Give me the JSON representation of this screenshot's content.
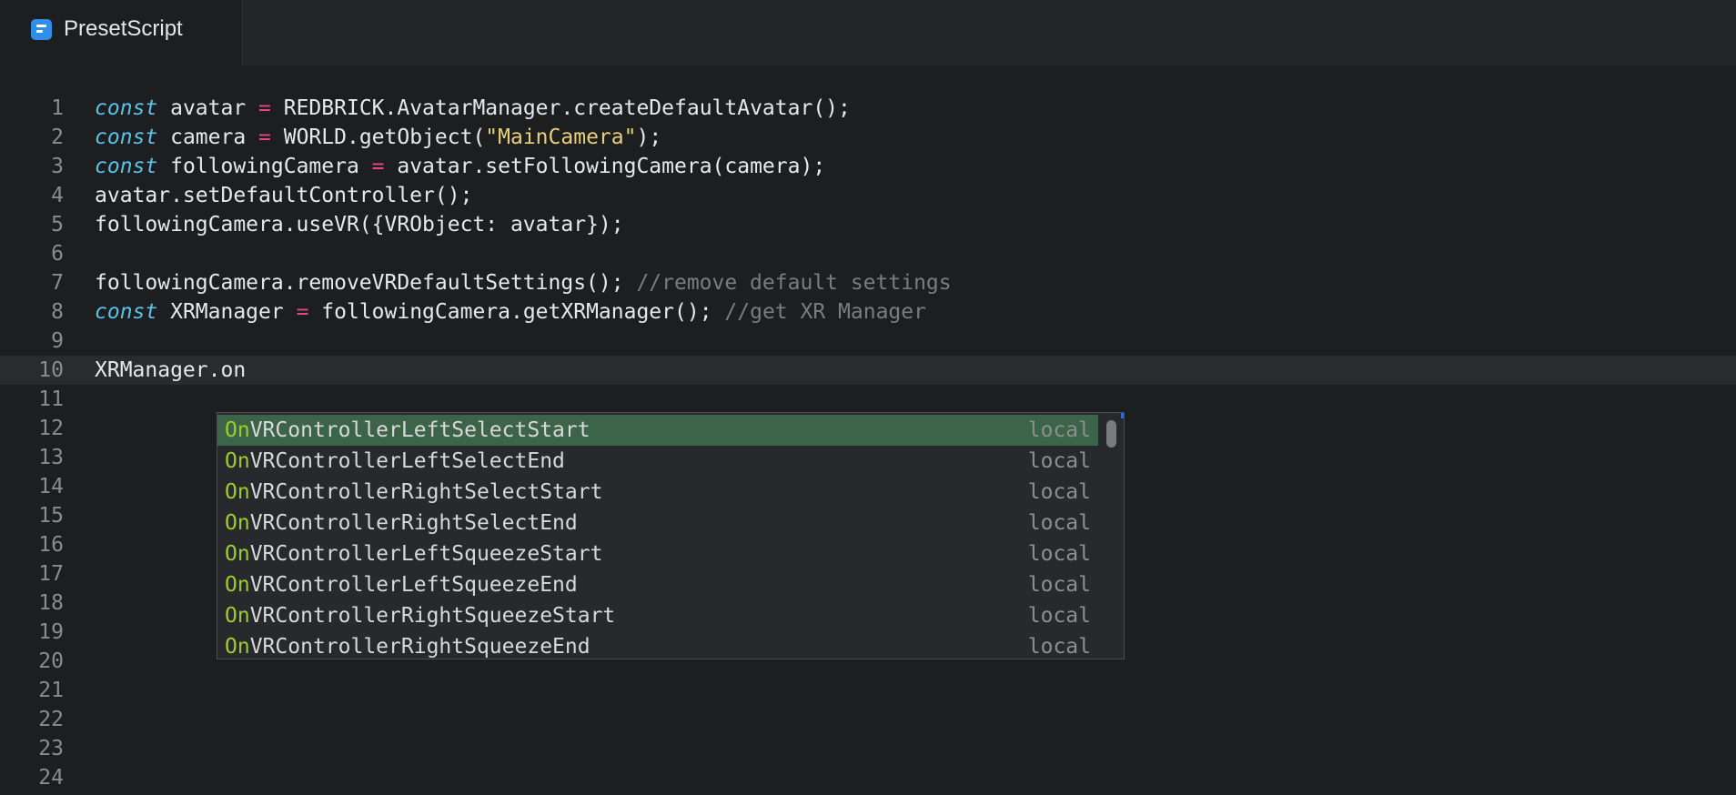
{
  "tab": {
    "icon": "document-icon",
    "label": "PresetScript"
  },
  "editor": {
    "lines": [
      {
        "num": "1",
        "tokens": [
          [
            "kw",
            "const"
          ],
          [
            "t",
            " avatar "
          ],
          [
            "op",
            "="
          ],
          [
            "t",
            " REDBRICK.AvatarManager.createDefaultAvatar();"
          ]
        ]
      },
      {
        "num": "2",
        "tokens": [
          [
            "kw",
            "const"
          ],
          [
            "t",
            " camera "
          ],
          [
            "op",
            "="
          ],
          [
            "t",
            " WORLD.getObject("
          ],
          [
            "str",
            "\"MainCamera\""
          ],
          [
            "t",
            ");"
          ]
        ]
      },
      {
        "num": "3",
        "tokens": [
          [
            "kw",
            "const"
          ],
          [
            "t",
            " followingCamera "
          ],
          [
            "op",
            "="
          ],
          [
            "t",
            " avatar.setFollowingCamera(camera);"
          ]
        ]
      },
      {
        "num": "4",
        "tokens": [
          [
            "t",
            "avatar.setDefaultController();"
          ]
        ]
      },
      {
        "num": "5",
        "tokens": [
          [
            "t",
            "followingCamera.useVR({VRObject: avatar});"
          ]
        ]
      },
      {
        "num": "6",
        "tokens": []
      },
      {
        "num": "7",
        "tokens": [
          [
            "t",
            "followingCamera.removeVRDefaultSettings(); "
          ],
          [
            "cm",
            "//remove default settings"
          ]
        ]
      },
      {
        "num": "8",
        "tokens": [
          [
            "kw",
            "const"
          ],
          [
            "t",
            " XRManager "
          ],
          [
            "op",
            "="
          ],
          [
            "t",
            " followingCamera.getXRManager(); "
          ],
          [
            "cm",
            "//get XR Manager"
          ]
        ]
      },
      {
        "num": "9",
        "tokens": []
      },
      {
        "num": "10",
        "tokens": [
          [
            "t",
            "XRManager.on"
          ]
        ]
      },
      {
        "num": "11",
        "tokens": []
      },
      {
        "num": "12",
        "tokens": []
      },
      {
        "num": "13",
        "tokens": []
      },
      {
        "num": "14",
        "tokens": []
      },
      {
        "num": "15",
        "tokens": []
      },
      {
        "num": "16",
        "tokens": []
      },
      {
        "num": "17",
        "tokens": []
      },
      {
        "num": "18",
        "tokens": []
      },
      {
        "num": "19",
        "tokens": []
      },
      {
        "num": "20",
        "tokens": []
      },
      {
        "num": "21",
        "tokens": []
      },
      {
        "num": "22",
        "tokens": []
      },
      {
        "num": "23",
        "tokens": []
      },
      {
        "num": "24",
        "tokens": []
      }
    ],
    "active_line": "10"
  },
  "autocomplete": {
    "items": [
      {
        "match": "On",
        "rest": "VRControllerLeftSelectStart",
        "kind": "local"
      },
      {
        "match": "On",
        "rest": "VRControllerLeftSelectEnd",
        "kind": "local"
      },
      {
        "match": "On",
        "rest": "VRControllerRightSelectStart",
        "kind": "local"
      },
      {
        "match": "On",
        "rest": "VRControllerRightSelectEnd",
        "kind": "local"
      },
      {
        "match": "On",
        "rest": "VRControllerLeftSqueezeStart",
        "kind": "local"
      },
      {
        "match": "On",
        "rest": "VRControllerLeftSqueezeEnd",
        "kind": "local"
      },
      {
        "match": "On",
        "rest": "VRControllerRightSqueezeStart",
        "kind": "local"
      },
      {
        "match": "On",
        "rest": "VRControllerRightSqueezeEnd",
        "kind": "local"
      }
    ],
    "selected_index": 0
  }
}
